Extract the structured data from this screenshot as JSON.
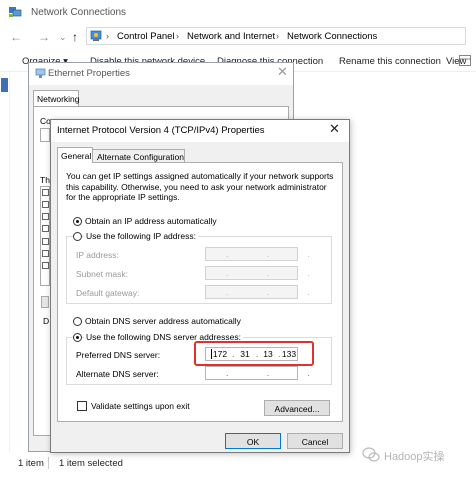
{
  "window": {
    "title": "Network Connections",
    "breadcrumb": [
      "Control Panel",
      "Network and Internet",
      "Network Connections"
    ],
    "toolbar": [
      "Organize ▾",
      "Disable this network device",
      "Diagnose this connection",
      "Rename this connection",
      "View"
    ],
    "status": {
      "count": "1 item",
      "selected": "1 item selected"
    }
  },
  "ethernet_dialog": {
    "title": "Ethernet Properties",
    "tab": "Networking",
    "fragments": {
      "con": "Co",
      "th": "Th",
      "d": "D"
    }
  },
  "ipv4_dialog": {
    "title": "Internet Protocol Version 4 (TCP/IPv4) Properties",
    "tabs": [
      "General",
      "Alternate Configuration"
    ],
    "description": "You can get IP settings assigned automatically if your network supports this capability. Otherwise, you need to ask your network administrator for the appropriate IP settings.",
    "ip_options": {
      "auto": "Obtain an IP address automatically",
      "manual": "Use the following IP address:",
      "selected": "auto"
    },
    "ip_fields": [
      {
        "label": "IP address:",
        "value": ". . ."
      },
      {
        "label": "Subnet mask:",
        "value": ". . ."
      },
      {
        "label": "Default gateway:",
        "value": ". . ."
      }
    ],
    "dns_options": {
      "auto": "Obtain DNS server address automatically",
      "manual": "Use the following DNS server addresses:",
      "selected": "manual"
    },
    "dns_fields": {
      "preferred_label": "Preferred DNS server:",
      "preferred_octets": [
        "172",
        "31",
        "13",
        "133"
      ],
      "alternate_label": "Alternate DNS server:"
    },
    "validate_label": "Validate settings upon exit",
    "advanced_label": "Advanced...",
    "ok_label": "OK",
    "cancel_label": "Cancel"
  },
  "watermark": {
    "text": "Hadoop实操"
  },
  "colors": {
    "highlight": "#e0312f",
    "accent": "#0078d7"
  }
}
